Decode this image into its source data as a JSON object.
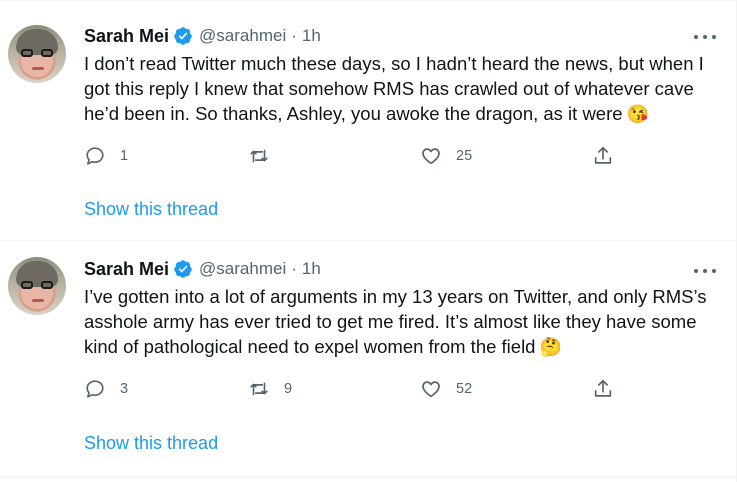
{
  "colors": {
    "link": "#1d9bf0",
    "verified": "#1d9bf0",
    "muted": "#536471",
    "text": "#0f1419"
  },
  "tweets": [
    {
      "display_name": "Sarah Mei",
      "handle": "@sarahmei",
      "separator": "·",
      "time": "1h",
      "verified_icon": "verified-badge-icon",
      "text": "I don’t read Twitter much these days, so I hadn’t heard the news, but when I got this reply I knew that somehow RMS has crawled out of whatever cave he’d been in. So thanks, Ashley, you awoke the dragon, as it were",
      "emoji": "😘",
      "reply_count": "1",
      "retweet_count": "",
      "like_count": "25",
      "show_thread": "Show this thread"
    },
    {
      "display_name": "Sarah Mei",
      "handle": "@sarahmei",
      "separator": "·",
      "time": "1h",
      "verified_icon": "verified-badge-icon",
      "text": "I’ve gotten into a lot of arguments in my 13 years on Twitter, and only RMS’s asshole army has ever tried to get me fired. It’s almost like they have some kind of pathological need to expel women from the field",
      "emoji": "🤔",
      "reply_count": "3",
      "retweet_count": "9",
      "like_count": "52",
      "show_thread": "Show this thread"
    }
  ]
}
